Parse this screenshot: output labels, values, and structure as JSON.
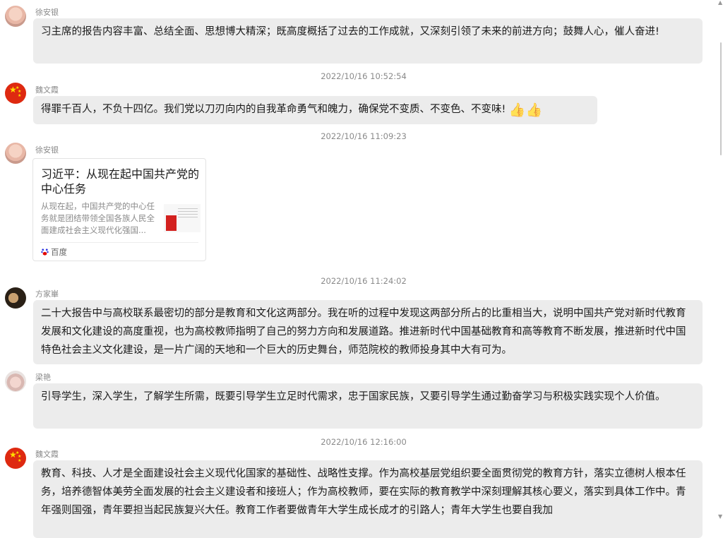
{
  "messages": [
    {
      "sender": "徐安银",
      "text": "习主席的报告内容丰富、总结全面、思想博大精深；既高度概括了过去的工作成就，又深刻引领了未来的前进方向；鼓舞人心，催人奋进!"
    },
    {
      "time": "2022/10/16 10:52:54",
      "sender": "魏文霞",
      "text": "得罪千百人，不负十四亿。我们党以刀刃向内的自我革命勇气和魄力，确保党不变质、不变色、不变味!",
      "emoji": "👍👍"
    },
    {
      "time": "2022/10/16 11:09:23",
      "sender": "徐安银",
      "card": {
        "title": "习近平：从现在起中国共产党的中心任务",
        "description": "从现在起，中国共产党的中心任务就是团结带领全国各族人民全面建成社会主义现代化强国...",
        "source": "百度"
      }
    },
    {
      "time": "2022/10/16 11:24:02",
      "sender": "方家崋",
      "text": "二十大报告中与高校联系最密切的部分是教育和文化这两部分。我在听的过程中发现这两部分所占的比重相当大，说明中国共产党对新时代教育发展和文化建设的高度重视，也为高校教师指明了自己的努力方向和发展道路。推进新时代中国基础教育和高等教育不断发展，推进新时代中国特色社会主义文化建设，是一片广阔的天地和一个巨大的历史舞台，师范院校的教师投身其中大有可为。"
    },
    {
      "sender": "梁艳",
      "text": "引导学生，深入学生，了解学生所需，既要引导学生立足时代需求，忠于国家民族，又要引导学生通过勤奋学习与积极实践实现个人价值。"
    },
    {
      "time": "2022/10/16 12:16:00",
      "sender": "魏文霞",
      "text": "教育、科技、人才是全面建设社会主义现代化国家的基础性、战略性支撑。作为高校基层党组织要全面贯彻党的教育方针，落实立德树人根本任务，培养德智体美劳全面发展的社会主义建设者和接班人；作为高校教师，要在实际的教育教学中深刻理解其核心要义，落实到具体工作中。青年强则国强，青年要担当起民族复兴大任。教育工作者要做青年大学生成长成才的引路人；青年大学生也要自我加"
    }
  ]
}
